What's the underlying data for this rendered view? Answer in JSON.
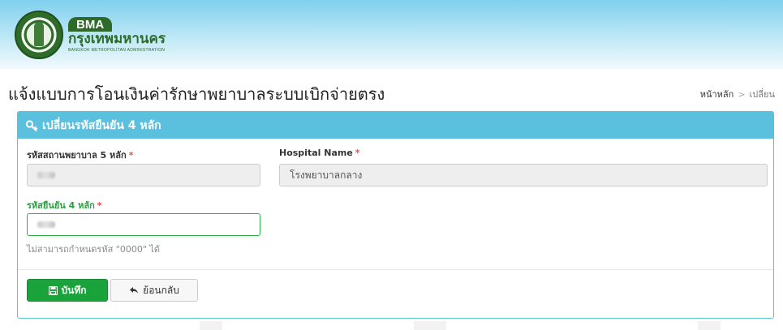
{
  "header": {
    "logo_bma": "BMA",
    "logo_thai": "กรุงเทพมหานคร",
    "logo_english": "BANGKOK METROPOLITAN ADMINISTRATION"
  },
  "page": {
    "title": "แจ้งแบบการโอนเงินค่ารักษาพยาบาลระบบเบิกจ่ายตรง"
  },
  "breadcrumb": {
    "home": "หน้าหลัก",
    "separator": ">",
    "current": "เปลี่ยน"
  },
  "panel": {
    "heading": "เปลี่ยนรหัสยืนยัน 4 หลัก",
    "hospital_code": {
      "label": "รหัสสถานพยาบาล 5 หลัก",
      "required": "*"
    },
    "hospital_name": {
      "label": "Hospital Name",
      "required": "*",
      "value": "โรงพยาบาลกลาง"
    },
    "pin": {
      "label": "รหัสยืนยัน 4 หลัก",
      "required": "*",
      "help": "ไม่สามารถกำหนดรหัส \"0000\" ได้"
    },
    "buttons": {
      "save": "บันทึก",
      "back": "ย้อนกลับ"
    }
  },
  "colors": {
    "panel_header": "#5bc0de",
    "save_button": "#1aa33a",
    "required": "#d9534f",
    "focus_border": "#2bb04a"
  }
}
